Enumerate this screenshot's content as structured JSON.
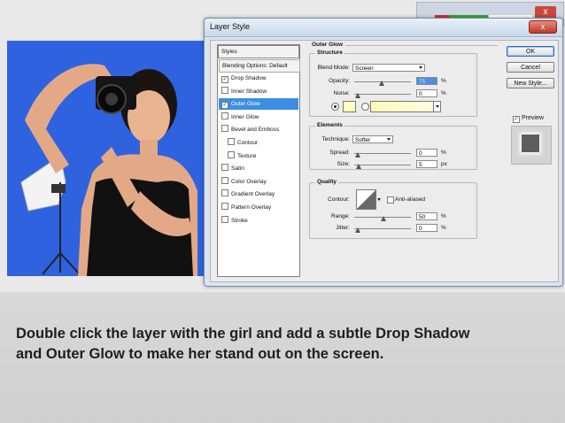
{
  "dialog": {
    "title": "Layer Style",
    "close_glyph": "x"
  },
  "styles_list": {
    "header": "Styles",
    "blending": "Blending Options: Default",
    "items": [
      {
        "label": "Drop Shadow",
        "checked": true,
        "selected": false,
        "indent": false
      },
      {
        "label": "Inner Shadow",
        "checked": false,
        "selected": false,
        "indent": false
      },
      {
        "label": "Outer Glow",
        "checked": true,
        "selected": true,
        "indent": false
      },
      {
        "label": "Inner Glow",
        "checked": false,
        "selected": false,
        "indent": false
      },
      {
        "label": "Bevel and Emboss",
        "checked": false,
        "selected": false,
        "indent": false
      },
      {
        "label": "Contour",
        "checked": false,
        "selected": false,
        "indent": true
      },
      {
        "label": "Texture",
        "checked": false,
        "selected": false,
        "indent": true
      },
      {
        "label": "Satin",
        "checked": false,
        "selected": false,
        "indent": false
      },
      {
        "label": "Color Overlay",
        "checked": false,
        "selected": false,
        "indent": false
      },
      {
        "label": "Gradient Overlay",
        "checked": false,
        "selected": false,
        "indent": false
      },
      {
        "label": "Pattern Overlay",
        "checked": false,
        "selected": false,
        "indent": false
      },
      {
        "label": "Stroke",
        "checked": false,
        "selected": false,
        "indent": false
      }
    ]
  },
  "outer_glow": {
    "title": "Outer Glow",
    "structure": {
      "title": "Structure",
      "blend_mode_label": "Blend Mode:",
      "blend_mode_value": "Screen",
      "opacity_label": "Opacity:",
      "opacity_value": "75",
      "noise_label": "Noise:",
      "noise_value": "0",
      "percent": "%",
      "glow_color": "#fffdc0",
      "gradient_colors": [
        "#fff9b8",
        "#fffde8"
      ]
    },
    "elements": {
      "title": "Elements",
      "technique_label": "Technique:",
      "technique_value": "Softer",
      "spread_label": "Spread:",
      "spread_value": "0",
      "size_label": "Size:",
      "size_value": "5",
      "percent": "%",
      "px": "px"
    },
    "quality": {
      "title": "Quality",
      "contour_label": "Contour:",
      "anti_aliased_label": "Anti-aliased",
      "range_label": "Range:",
      "range_value": "50",
      "jitter_label": "Jitter:",
      "jitter_value": "0",
      "percent": "%"
    }
  },
  "buttons": {
    "ok": "OK",
    "cancel": "Cancel",
    "new_style": "New Style...",
    "preview": "Preview",
    "preview_checked": true
  },
  "caption": {
    "line1": "Double click the layer with the girl and add a subtle Drop Shadow",
    "line2": "and Outer Glow to make her stand out on the screen."
  },
  "colors": {
    "photo_bg": "#2f62df",
    "selection": "#3c8fe0"
  }
}
